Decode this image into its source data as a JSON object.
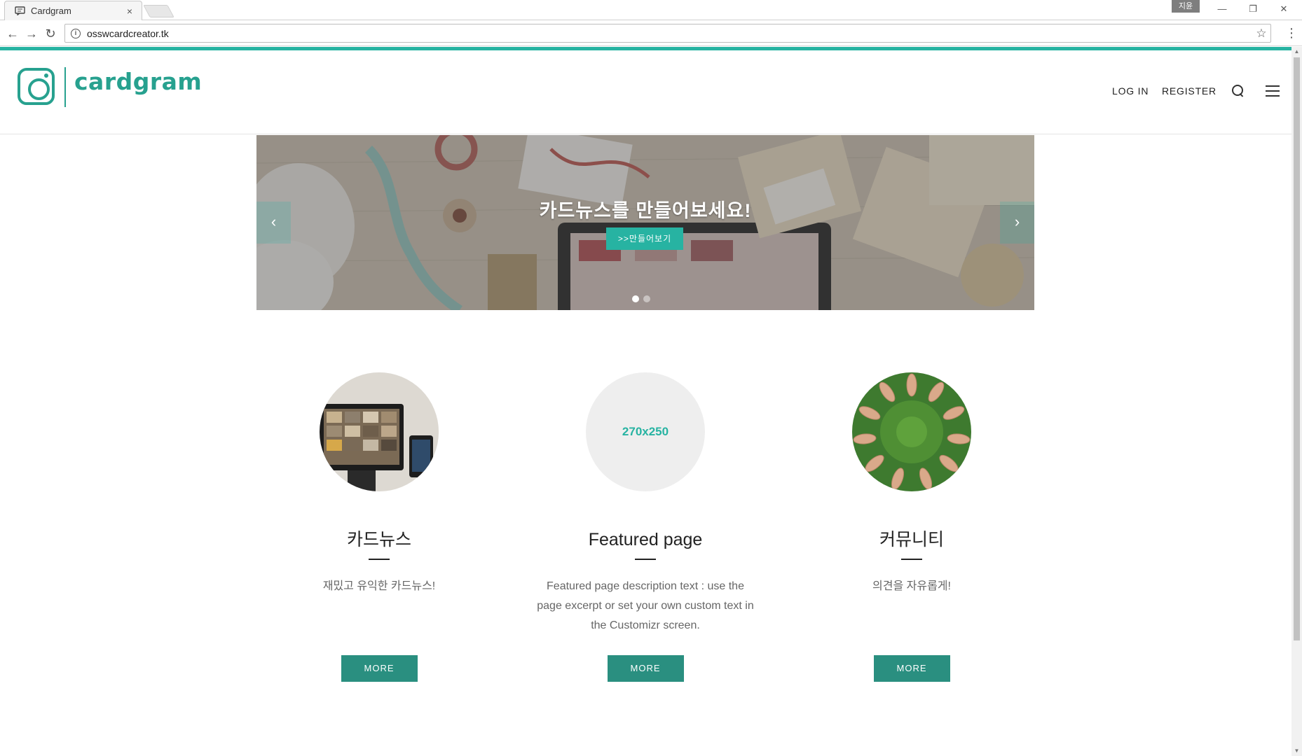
{
  "browser": {
    "tab_title": "Cardgram",
    "tab_close": "×",
    "user_badge": "지윤",
    "url": "osswcardcreator.tk",
    "back": "←",
    "forward": "→",
    "reload": "↻",
    "info": "i",
    "bookmark": "☆",
    "menu": "⋮",
    "minimize": "—",
    "restore": "❐",
    "close": "✕"
  },
  "header": {
    "logo_text": "cardgram",
    "nav": {
      "login": "LOG IN",
      "register": "REGISTER"
    },
    "accent_color": "#27b3a2"
  },
  "hero": {
    "title": "카드뉴스를 만들어보세요!",
    "button_label": ">>만들어보기",
    "prev_arrow": "‹",
    "next_arrow": "›",
    "slide_count": 2,
    "active_slide": 1
  },
  "features": [
    {
      "title": "카드뉴스",
      "description": "재밌고 유익한 카드뉴스!",
      "image_placeholder": "",
      "button": "MORE"
    },
    {
      "title": "Featured page",
      "description": "Featured page description text : use the page excerpt or set your own custom text in the Customizr screen.",
      "image_placeholder": "270x250",
      "button": "MORE"
    },
    {
      "title": "커뮤니티",
      "description": "의견을 자유롭게!",
      "image_placeholder": "",
      "button": "MORE"
    }
  ],
  "colors": {
    "brand": "#27a18f",
    "button": "#2a8f80",
    "accent": "#27b3a2"
  }
}
